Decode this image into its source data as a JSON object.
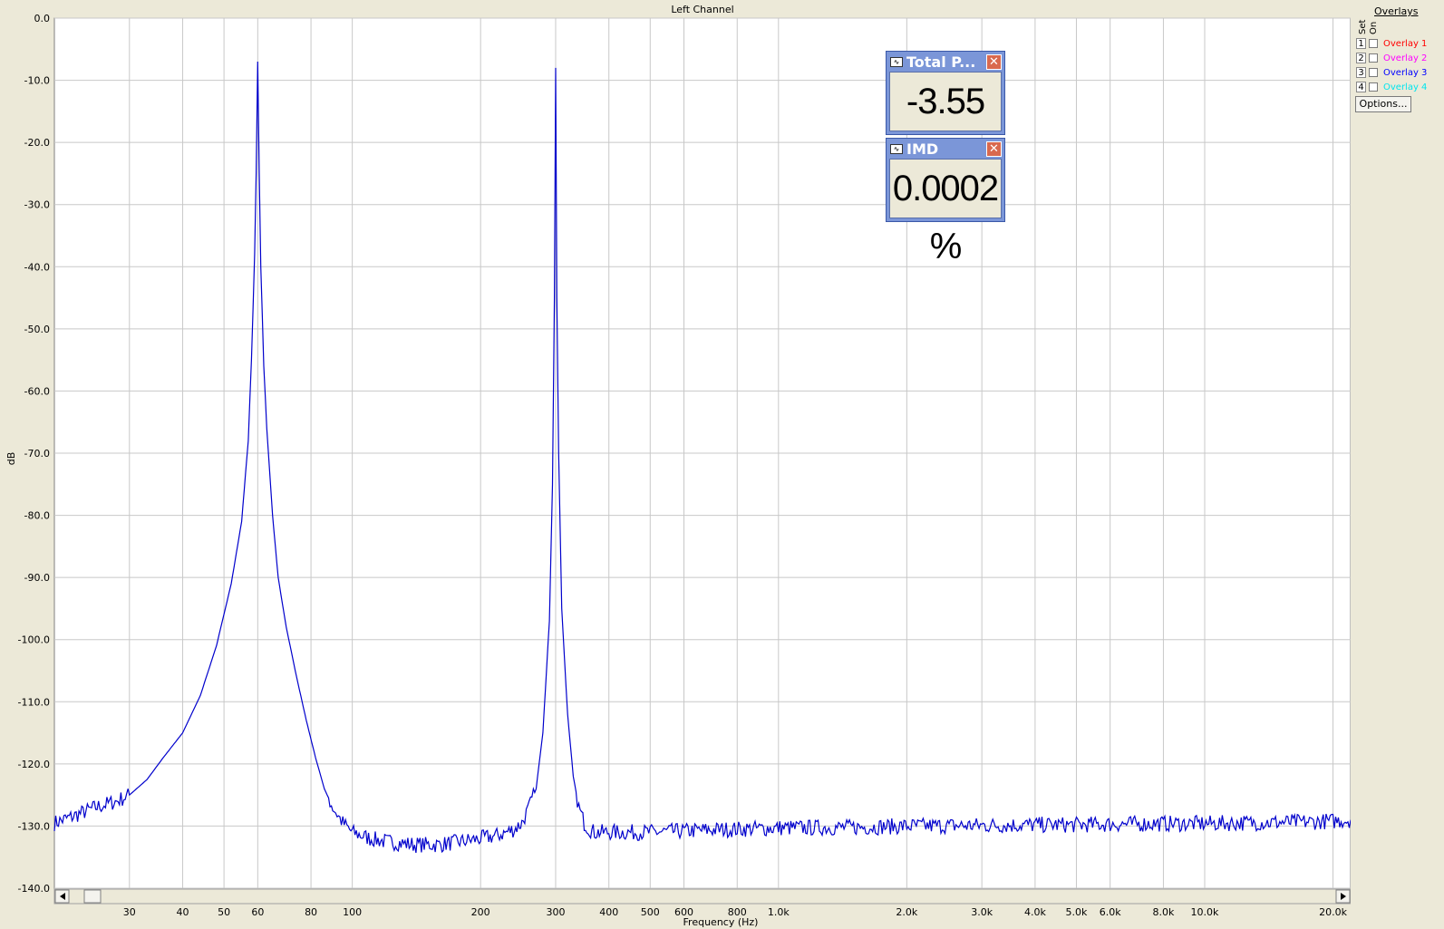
{
  "chart_data": {
    "type": "line",
    "title": "Left Channel",
    "xlabel": "Frequency (Hz)",
    "ylabel": "dB",
    "xscale": "log",
    "xlim": [
      20,
      22000
    ],
    "ylim": [
      -140,
      0
    ],
    "grid": true,
    "x_ticks": [
      {
        "v": 30,
        "label": "30"
      },
      {
        "v": 40,
        "label": "40"
      },
      {
        "v": 50,
        "label": "50"
      },
      {
        "v": 60,
        "label": "60"
      },
      {
        "v": 80,
        "label": "80"
      },
      {
        "v": 100,
        "label": "100"
      },
      {
        "v": 200,
        "label": "200"
      },
      {
        "v": 300,
        "label": "300"
      },
      {
        "v": 400,
        "label": "400"
      },
      {
        "v": 500,
        "label": "500"
      },
      {
        "v": 600,
        "label": "600"
      },
      {
        "v": 800,
        "label": "800"
      },
      {
        "v": 1000,
        "label": "1.0k"
      },
      {
        "v": 2000,
        "label": "2.0k"
      },
      {
        "v": 3000,
        "label": "3.0k"
      },
      {
        "v": 4000,
        "label": "4.0k"
      },
      {
        "v": 5000,
        "label": "5.0k"
      },
      {
        "v": 6000,
        "label": "6.0k"
      },
      {
        "v": 8000,
        "label": "8.0k"
      },
      {
        "v": 10000,
        "label": "10.0k"
      },
      {
        "v": 20000,
        "label": "20.0k"
      }
    ],
    "y_ticks": [
      {
        "v": 0,
        "label": "0.0"
      },
      {
        "v": -10,
        "label": "-10.0"
      },
      {
        "v": -20,
        "label": "-20.0"
      },
      {
        "v": -30,
        "label": "-30.0"
      },
      {
        "v": -40,
        "label": "-40.0"
      },
      {
        "v": -50,
        "label": "-50.0"
      },
      {
        "v": -60,
        "label": "-60.0"
      },
      {
        "v": -70,
        "label": "-70.0"
      },
      {
        "v": -80,
        "label": "-80.0"
      },
      {
        "v": -90,
        "label": "-90.0"
      },
      {
        "v": -100,
        "label": "-100.0"
      },
      {
        "v": -110,
        "label": "-110.0"
      },
      {
        "v": -120,
        "label": "-120.0"
      },
      {
        "v": -130,
        "label": "-130.0"
      },
      {
        "v": -140,
        "label": "-140.0"
      }
    ],
    "series": [
      {
        "color": "#0000cc",
        "x": [
          20,
          22,
          25,
          28,
          30,
          33,
          36,
          40,
          44,
          48,
          52,
          55,
          57,
          58,
          59,
          59.5,
          60,
          60.5,
          61,
          62,
          63,
          65,
          67,
          70,
          74,
          78,
          82,
          86,
          90,
          95,
          100,
          110,
          120,
          140,
          160,
          180,
          200,
          220,
          240,
          250,
          260,
          270,
          280,
          290,
          295,
          298,
          300,
          302,
          305,
          310,
          320,
          330,
          340,
          350,
          360,
          370,
          380,
          400,
          450,
          500,
          600,
          700,
          800,
          1000,
          1500,
          2000,
          3000,
          4000,
          5000,
          6000,
          8000,
          10000,
          12000,
          15000,
          18000,
          20000,
          22000
        ],
        "y": [
          -129.5,
          -128.5,
          -127,
          -126,
          -125,
          -122.5,
          -119,
          -115,
          -109,
          -101,
          -91,
          -81,
          -68,
          -55,
          -38,
          -25,
          -7,
          -25,
          -40,
          -56,
          -66,
          -80,
          -90,
          -98,
          -106,
          -113,
          -119,
          -124,
          -127,
          -129.5,
          -131,
          -132,
          -132.5,
          -133,
          -133,
          -132.5,
          -132,
          -131.5,
          -130.5,
          -129.5,
          -127,
          -124,
          -115,
          -97,
          -75,
          -45,
          -8,
          -45,
          -70,
          -95,
          -112,
          -122,
          -127,
          -129.5,
          -130.5,
          -131,
          -131,
          -131,
          -131,
          -131,
          -130.8,
          -130.6,
          -130.5,
          -130.3,
          -130.2,
          -130,
          -129.9,
          -129.8,
          -129.8,
          -129.7,
          -129.6,
          -129.6,
          -129.5,
          -129.4,
          -129.3,
          -129.2,
          -129
        ]
      }
    ]
  },
  "overlays": {
    "title": "Overlays",
    "set_header": "Set",
    "on_header": "On",
    "items": [
      {
        "set": "1",
        "label": "Overlay 1",
        "color": "#ff0000"
      },
      {
        "set": "2",
        "label": "Overlay 2",
        "color": "#ff00ff"
      },
      {
        "set": "3",
        "label": "Overlay 3",
        "color": "#0000ff"
      },
      {
        "set": "4",
        "label": "Overlay 4",
        "color": "#00e5ee"
      }
    ],
    "options_label": "Options..."
  },
  "meters": [
    {
      "title": "Total P...",
      "value": "-3.55 dB"
    },
    {
      "title": "IMD",
      "value": "0.0002 %"
    }
  ]
}
